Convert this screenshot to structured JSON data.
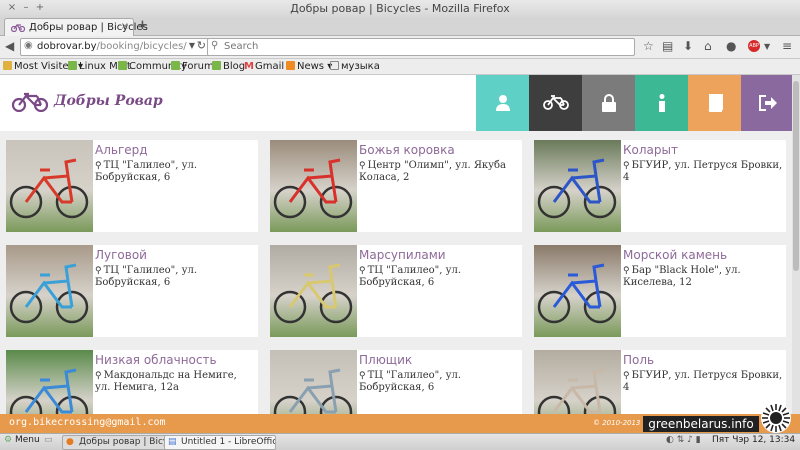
{
  "window": {
    "title": "Добры ровар | Bicycles - Mozilla Firefox"
  },
  "tab": {
    "title": "Добры ровар | Bicycles"
  },
  "navbar": {
    "url_host": "dobrovar.by",
    "url_path": "/booking/bicycles/",
    "search_placeholder": "Search"
  },
  "bookmarks": [
    {
      "label": "Most Visited ▾"
    },
    {
      "label": "Linux Mint"
    },
    {
      "label": "Community"
    },
    {
      "label": "Forums"
    },
    {
      "label": "Blog"
    },
    {
      "label": "Gmail"
    },
    {
      "label": "News ▾"
    },
    {
      "label": "музыка"
    }
  ],
  "site": {
    "logo": "Добры Ровар",
    "nav": [
      {
        "icon": "user-icon",
        "color": "#5fd0c6"
      },
      {
        "icon": "bicycle-icon",
        "color": "#3e3e3e"
      },
      {
        "icon": "lock-icon",
        "color": "#7b7b7b"
      },
      {
        "icon": "info-icon",
        "color": "#3db894"
      },
      {
        "icon": "book-icon",
        "color": "#eea35c"
      },
      {
        "icon": "logout-icon",
        "color": "#8a6a9e"
      }
    ]
  },
  "bicycles": [
    {
      "name": "Альгерд",
      "address": "ТЦ \"Галилео\", ул. Бобруйская, 6",
      "color": "#d83a2a"
    },
    {
      "name": "Божья коровка",
      "address": "Центр \"Олимп\", ул. Якуба Коласа, 2",
      "color": "#d8302a"
    },
    {
      "name": "Коларыт",
      "address": "БГУИР, ул. Петруся Бровки, 4",
      "color": "#2c55c8"
    },
    {
      "name": "Луговой",
      "address": "ТЦ \"Галилео\", ул. Бобруйская, 6",
      "color": "#3aa0d8"
    },
    {
      "name": "Марсупилами",
      "address": "ТЦ \"Галилео\", ул. Бобруйская, 6",
      "color": "#d8c870"
    },
    {
      "name": "Морской камень",
      "address": "Бар \"Black Hole\", ул. Киселева, 12",
      "color": "#2a5ad8"
    },
    {
      "name": "Низкая облачность",
      "address": "Макдональдс на Немиге, ул. Немига, 12а",
      "color": "#3a8ad8"
    },
    {
      "name": "Плющик",
      "address": "ТЦ \"Галилео\", ул. Бобруйская, 6",
      "color": "#8aa0b0"
    },
    {
      "name": "Поль",
      "address": "БГУИР, ул. Петруся Бровки, 4",
      "color": "#c8b8a8"
    }
  ],
  "footer": {
    "email": "org.bikecrossing@gmail.com",
    "copyright": "© 2010-2013",
    "watermark": "greenbelarus.info"
  },
  "taskbar": {
    "menu": "Menu",
    "windows": [
      "Добры ровар | Bicycl...",
      "Untitled 1 - LibreOffic..."
    ],
    "clock": "Пят Чэр 12, 13:34"
  }
}
